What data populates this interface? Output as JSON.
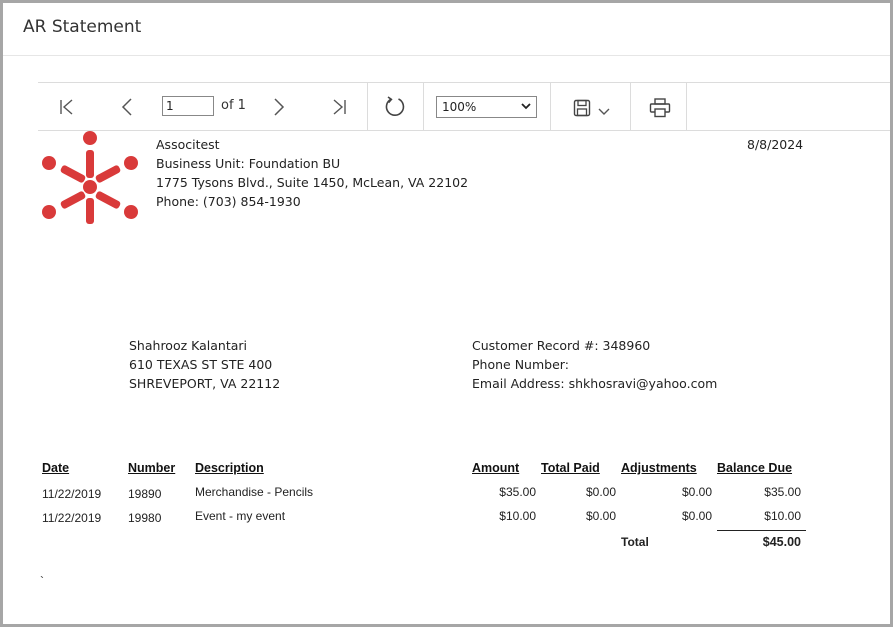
{
  "window": {
    "title": "AR Statement"
  },
  "toolbar": {
    "page_value": "1",
    "page_of": "of 1",
    "zoom_value": "100%",
    "icons": [
      "first-page-icon",
      "prev-page-icon",
      "next-page-icon",
      "last-page-icon",
      "refresh-icon",
      "save-icon",
      "chevron-down-icon",
      "print-icon"
    ]
  },
  "company": {
    "name": "Associtest",
    "business_unit": "Business Unit: Foundation BU",
    "address": "1775 Tysons Blvd., Suite 1450, McLean, VA 22102",
    "phone": "Phone: (703) 854-1930",
    "logo_color": "#d93a3a"
  },
  "statement_date": "8/8/2024",
  "customer": {
    "name": "Shahrooz Kalantari",
    "address1": "610 TEXAS ST STE 400",
    "address2": "SHREVEPORT, VA 22112",
    "record": "Customer Record #: 348960",
    "phone": "Phone Number:",
    "email": "Email Address: shkhosravi@yahoo.com"
  },
  "table": {
    "headers": {
      "date": "Date",
      "number": "Number",
      "description": "Description",
      "amount": "Amount",
      "total_paid": "Total Paid",
      "adjustments": "Adjustments",
      "balance_due": "Balance Due"
    },
    "rows": [
      {
        "date": "11/22/2019",
        "number": "19890",
        "description": "Merchandise - Pencils",
        "amount": "$35.00",
        "total_paid": "$0.00",
        "adjustments": "$0.00",
        "balance_due": "$35.00"
      },
      {
        "date": "11/22/2019",
        "number": "19980",
        "description": "Event - my event",
        "amount": "$10.00",
        "total_paid": "$0.00",
        "adjustments": "$0.00",
        "balance_due": "$10.00"
      }
    ],
    "total_label": "Total",
    "total_value": "$45.00"
  },
  "footer_mark": "`"
}
